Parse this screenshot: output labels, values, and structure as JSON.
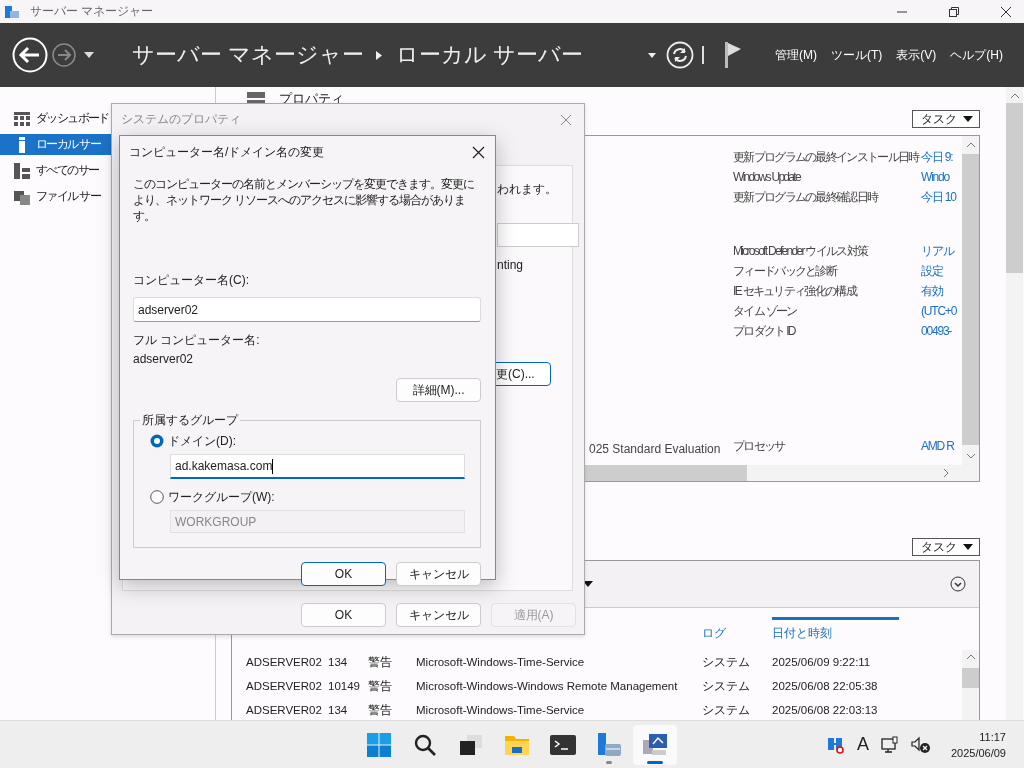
{
  "window": {
    "title": "サーバー マネージャー"
  },
  "header": {
    "breadcrumb": [
      "サーバー マネージャー",
      "ローカル サーバー"
    ],
    "menus": [
      "管理(M)",
      "ツール(T)",
      "表示(V)",
      "ヘルプ(H)"
    ]
  },
  "sidebar": {
    "items": [
      {
        "label": "ダッシュボード",
        "kind": "dashboard",
        "selected": false
      },
      {
        "label": "ローカル サー",
        "kind": "local",
        "selected": true
      },
      {
        "label": "すべてのサー",
        "kind": "all",
        "selected": false
      },
      {
        "label": "ファイル サー",
        "kind": "files",
        "selected": false
      }
    ]
  },
  "properties": {
    "title": "プロパティ",
    "tasks_button": "タスク",
    "left_texts": [
      "025 Standard Evaluation"
    ],
    "groups": [
      [
        {
          "label": "更新プログラムの最終インストール日時",
          "value": "今日 9:"
        },
        {
          "label": "Windows Update",
          "value": "Windo"
        },
        {
          "label": "更新プログラムの最終確認日時",
          "value": "今日 10"
        }
      ],
      [
        {
          "label": "Microsoft Defender ウイルス対策",
          "value": "リアル"
        },
        {
          "label": "フィードバックと診断",
          "value": "設定"
        },
        {
          "label": "IE セキュリティ強化の構成",
          "value": "有効"
        },
        {
          "label": "タイム ゾーン",
          "value": "(UTC+0"
        },
        {
          "label": "プロダクト ID",
          "value": "00493-"
        }
      ],
      [
        {
          "label": "プロセッサ",
          "value": "AMD R"
        }
      ]
    ]
  },
  "events": {
    "tasks_button": "タスク",
    "columns": [
      {
        "label": "ログ",
        "sorted": false
      },
      {
        "label": "日付と時刻",
        "sorted": true
      }
    ],
    "rows": [
      {
        "server": "ADSERVER02",
        "id": "134",
        "level": "警告",
        "source": "Microsoft-Windows-Time-Service",
        "log": "システム",
        "date": "2025/06/09 9:22:11"
      },
      {
        "server": "ADSERVER02",
        "id": "10149",
        "level": "警告",
        "source": "Microsoft-Windows-Windows Remote Management",
        "log": "システム",
        "date": "2025/06/08 22:05:38"
      },
      {
        "server": "ADSERVER02",
        "id": "134",
        "level": "警告",
        "source": "Microsoft-Windows-Time-Service",
        "log": "システム",
        "date": "2025/06/08 22:03:13"
      }
    ]
  },
  "system_properties_dialog": {
    "title": "システムのプロパティ",
    "page_texts": [
      "われます。",
      "nting"
    ],
    "page_button": "更(C)...",
    "buttons": [
      {
        "label": "OK",
        "disabled": false
      },
      {
        "label": "キャンセル",
        "disabled": false
      },
      {
        "label": "適用(A)",
        "disabled": true
      }
    ]
  },
  "rename_dialog": {
    "title": "コンピューター名/ドメイン名の変更",
    "description": "このコンピューターの名前とメンバーシップを変更できます。変更により、ネットワーク リソースへのアクセスに影響する場合があります。",
    "computer_name_label": "コンピューター名(C):",
    "computer_name": "adserver02",
    "full_name_label": "フル コンピューター名:",
    "full_name": "adserver02",
    "details_button": "詳細(M)...",
    "member_of": {
      "legend": "所属するグループ",
      "options": [
        {
          "label": "ドメイン(D):",
          "selected": true,
          "value": "ad.kakemasa.com"
        },
        {
          "label": "ワークグループ(W):",
          "selected": false,
          "value": "WORKGROUP"
        }
      ]
    },
    "buttons": [
      {
        "label": "OK",
        "default": true
      },
      {
        "label": "キャンセル",
        "default": false
      }
    ]
  },
  "taskbar": {
    "apps": [
      {
        "kind": "start",
        "running": false,
        "active": false
      },
      {
        "kind": "search",
        "running": false,
        "active": false
      },
      {
        "kind": "task-view",
        "running": false,
        "active": false
      },
      {
        "kind": "explorer",
        "running": false,
        "active": false
      },
      {
        "kind": "terminal",
        "running": false,
        "active": false
      },
      {
        "kind": "server-manager",
        "running": true,
        "active": false
      },
      {
        "kind": "system-properties",
        "running": true,
        "active": true
      }
    ],
    "ime": "A",
    "clock": {
      "time": "11:17",
      "date": "2025/06/09"
    }
  }
}
